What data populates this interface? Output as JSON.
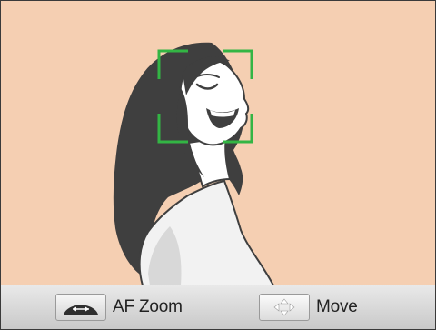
{
  "focus_frame": {
    "color": "#33b544"
  },
  "scene": {
    "background": "#f5cfb2",
    "subject": "woman-laughing-illustration"
  },
  "guide_bar": {
    "items": [
      {
        "icon": "zoom-lever-icon",
        "label": "AF Zoom"
      },
      {
        "icon": "directional-pad-icon",
        "label": "Move"
      }
    ]
  }
}
